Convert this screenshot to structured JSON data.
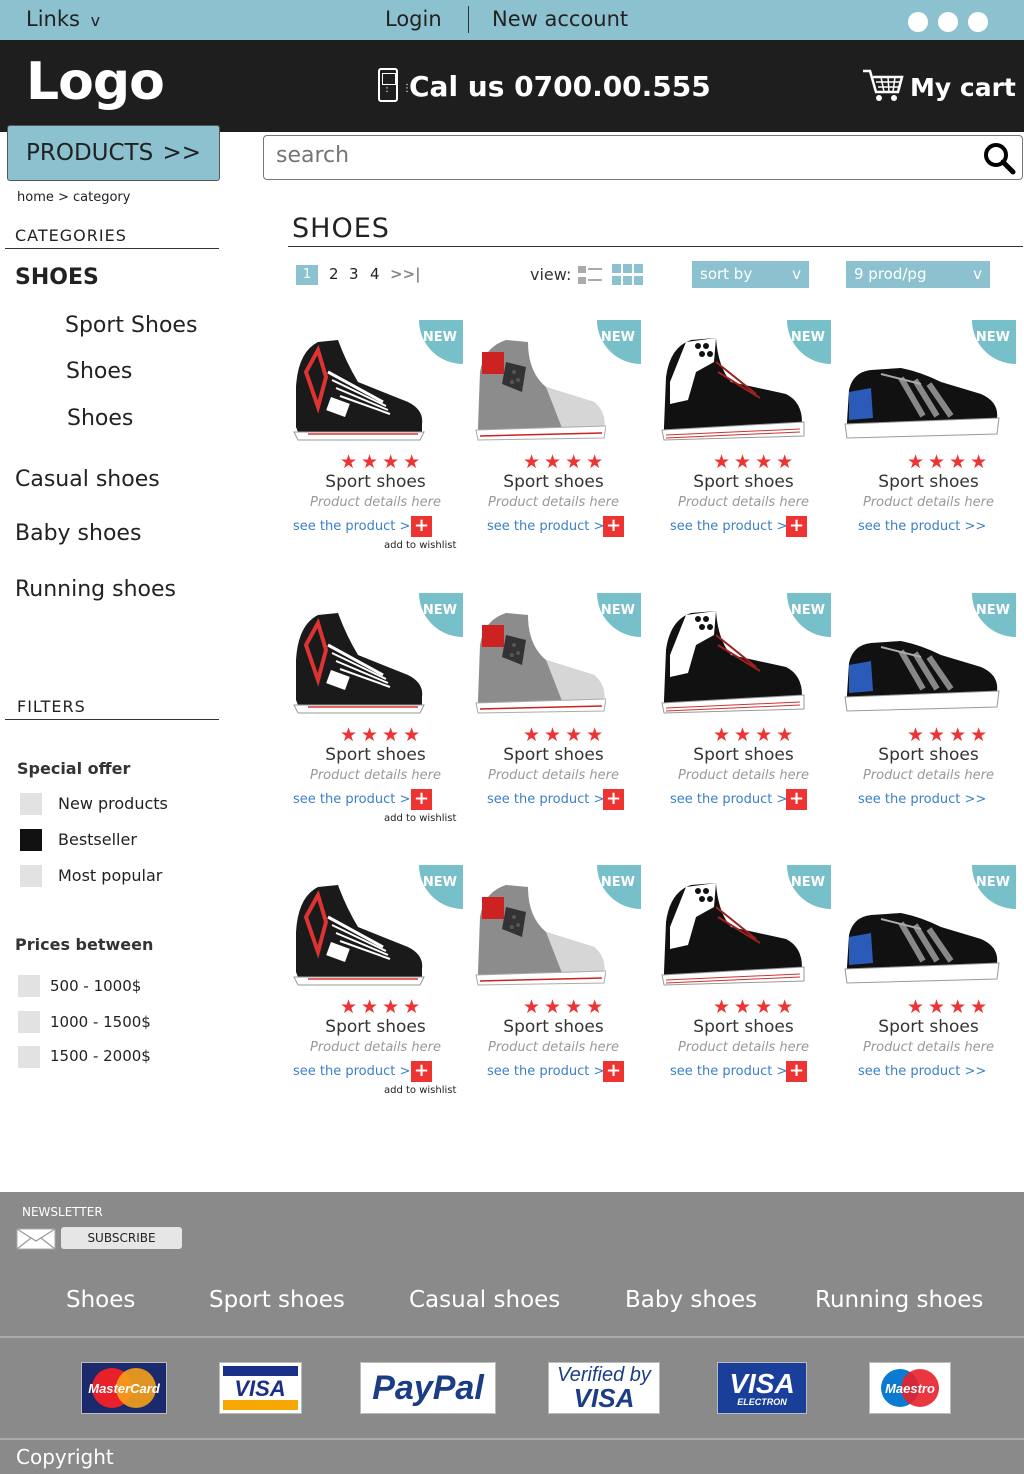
{
  "topbar": {
    "links_label": "Links",
    "links_chevron": "v",
    "login": "Login",
    "new_account": "New account"
  },
  "header": {
    "logo": "Logo",
    "call_us": "Cal us  0700.00.555",
    "my_cart": "My cart"
  },
  "nav": {
    "products_label": "PRODUCTS",
    "products_arrow": ">>"
  },
  "search": {
    "placeholder": "search"
  },
  "breadcrumb": "home > category",
  "sidebar": {
    "categories_title": "CATEGORIES",
    "active_category": "SHOES",
    "subcategories": [
      "Sport Shoes",
      "Shoes",
      "Shoes"
    ],
    "categories": [
      "Casual shoes",
      "Baby shoes",
      "Running shoes"
    ],
    "filters_title": "FILTERS",
    "special_offer_title": "Special offer",
    "special_offers": [
      {
        "label": "New products",
        "checked": false
      },
      {
        "label": "Bestseller",
        "checked": true
      },
      {
        "label": "Most popular",
        "checked": false
      }
    ],
    "prices_title": "Prices between",
    "prices": [
      {
        "label": "500 - 1000$",
        "checked": false
      },
      {
        "label": "1000 - 1500$",
        "checked": false
      },
      {
        "label": "1500 - 2000$",
        "checked": false
      }
    ]
  },
  "main": {
    "title": "SHOES",
    "pagination": {
      "current": "1",
      "pages": [
        "2",
        "3",
        "4"
      ],
      "next": ">>|"
    },
    "view_label": "view:",
    "sort_by": "sort by",
    "per_page": "9 prod/pg",
    "dropdown_chevron": "v"
  },
  "product_template": {
    "badge": "NEW",
    "stars": "★★★★",
    "rating": 4,
    "name": "Sport shoes",
    "details": "Product details here",
    "see": "see the product  >>",
    "plus": "+",
    "wishlist": "add to wishlist"
  },
  "footer": {
    "newsletter": "NEWSLETTER",
    "subscribe": "SUBSCRIBE",
    "links": [
      "Shoes",
      "Sport shoes",
      "Casual shoes",
      "Baby shoes",
      "Running shoes"
    ],
    "payment_labels": [
      "MasterCard",
      "VISA",
      "PayPal",
      "Verified by",
      "VISA",
      "VISA",
      "ELECTRON",
      "Maestro"
    ],
    "copyright": "Copyright"
  },
  "colors": {
    "accent": "#8cc2cf",
    "header_bg": "#1e1e1e",
    "star": "#e33333",
    "badge": "#78c0c9",
    "link": "#3a7fc7",
    "footer_bg": "#8a8a8a"
  }
}
